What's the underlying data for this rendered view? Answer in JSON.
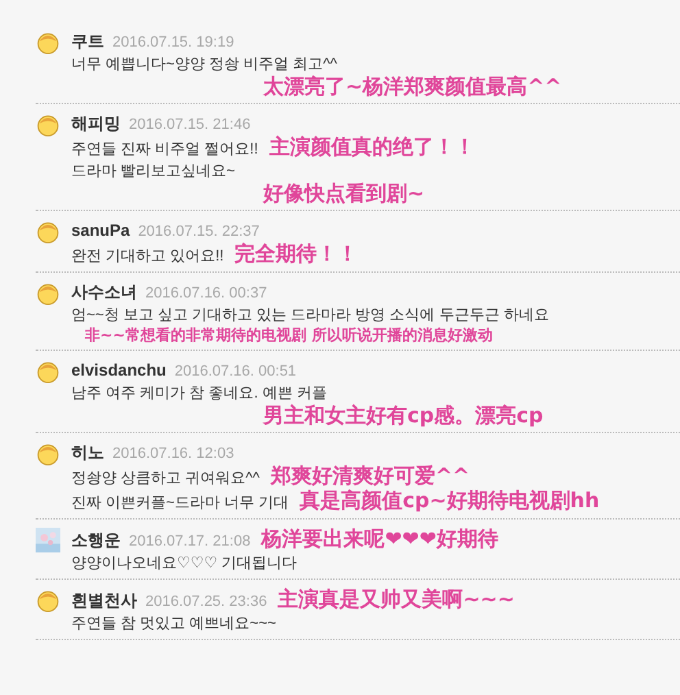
{
  "comments": [
    {
      "kind": "face",
      "author": "쿠트",
      "date": "2016.07.15. 19:19",
      "lines": [
        {
          "text": "너무 예쁩니다~양양 정솽 비주얼 최고^^"
        }
      ],
      "note_below": "太漂亮了~杨洋郑爽颜值最高^^"
    },
    {
      "kind": "face",
      "author": "해피밍",
      "date": "2016.07.15. 21:46",
      "lines": [
        {
          "text": "주연들 진짜 비주얼 쩔어요!!",
          "note": "主演颜值真的绝了！！"
        },
        {
          "text": "드라마 빨리보고싶네요~"
        }
      ],
      "note_below": "好像快点看到剧~"
    },
    {
      "kind": "face",
      "author": "sanuPa",
      "date": "2016.07.15. 22:37",
      "lines": [
        {
          "text": "완전 기대하고 있어요!!",
          "note": "完全期待！！"
        }
      ]
    },
    {
      "kind": "face",
      "author": "사수소녀",
      "date": "2016.07.16. 00:37",
      "lines": [
        {
          "text": "엄~~청 보고 싶고 기대하고 있는 드라마라 방영 소식에 두근두근 하네요"
        }
      ],
      "note_below": "非~~常想看的非常期待的电视剧 所以听说开播的消息好激动"
    },
    {
      "kind": "face",
      "author": "elvisdanchu",
      "date": "2016.07.16. 00:51",
      "lines": [
        {
          "text": "남주 여주 케미가 참 좋네요. 예쁜 커플"
        }
      ],
      "note_below": "男主和女主好有cp感。漂亮cp"
    },
    {
      "kind": "face",
      "author": "히노",
      "date": "2016.07.16. 12:03",
      "lines": [
        {
          "text": "정솽양 상큼하고 귀여워요^^",
          "note": "郑爽好清爽好可爱^^"
        },
        {
          "text": "진짜 이쁜커플~드라마 너무 기대",
          "note": "真是高颜值cp~好期待电视剧hh"
        }
      ]
    },
    {
      "kind": "picture",
      "author": "소행운",
      "date": "2016.07.17. 21:08",
      "header_note": "杨洋要出来呢❤❤❤好期待",
      "lines": [
        {
          "text": "양양이나오네요♡♡♡ 기대됩니다"
        }
      ]
    },
    {
      "kind": "face",
      "author": "흰별천사",
      "date": "2016.07.25. 23:36",
      "header_note": "主演真是又帅又美啊~~~",
      "lines": [
        {
          "text": "주연들 참 멋있고 예쁘네요~~~"
        }
      ]
    }
  ]
}
